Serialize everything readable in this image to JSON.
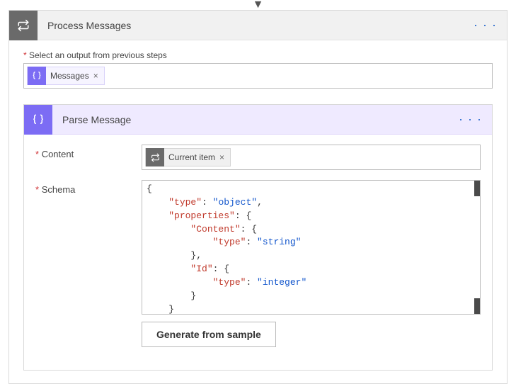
{
  "outer": {
    "arrow_glyph": "▼",
    "icon_glyph": "refresh-loop",
    "title": "Process Messages",
    "more_glyph": "· · ·",
    "field_label_prefix": "*",
    "field_label": "Select an output from previous steps",
    "token": {
      "icon": "braces",
      "label": "Messages",
      "remove_glyph": "×"
    }
  },
  "inner": {
    "icon_glyph": "braces",
    "title": "Parse Message",
    "more_glyph": "· · ·",
    "content": {
      "label_prefix": "*",
      "label": "Content",
      "token": {
        "icon": "refresh-loop",
        "label": "Current item",
        "remove_glyph": "×"
      }
    },
    "schema": {
      "label_prefix": "*",
      "label": "Schema",
      "lines": [
        {
          "indent": 0,
          "parts": [
            {
              "t": "plain",
              "v": "{"
            }
          ]
        },
        {
          "indent": 1,
          "parts": [
            {
              "t": "key",
              "v": "\"type\""
            },
            {
              "t": "plain",
              "v": ": "
            },
            {
              "t": "val",
              "v": "\"object\""
            },
            {
              "t": "plain",
              "v": ","
            }
          ]
        },
        {
          "indent": 1,
          "parts": [
            {
              "t": "key",
              "v": "\"properties\""
            },
            {
              "t": "plain",
              "v": ": {"
            }
          ]
        },
        {
          "indent": 2,
          "parts": [
            {
              "t": "key",
              "v": "\"Content\""
            },
            {
              "t": "plain",
              "v": ": {"
            }
          ]
        },
        {
          "indent": 3,
          "parts": [
            {
              "t": "key",
              "v": "\"type\""
            },
            {
              "t": "plain",
              "v": ": "
            },
            {
              "t": "val",
              "v": "\"string\""
            }
          ]
        },
        {
          "indent": 2,
          "parts": [
            {
              "t": "plain",
              "v": "},"
            }
          ]
        },
        {
          "indent": 2,
          "parts": [
            {
              "t": "key",
              "v": "\"Id\""
            },
            {
              "t": "plain",
              "v": ": {"
            }
          ]
        },
        {
          "indent": 3,
          "parts": [
            {
              "t": "key",
              "v": "\"type\""
            },
            {
              "t": "plain",
              "v": ": "
            },
            {
              "t": "val",
              "v": "\"integer\""
            }
          ]
        },
        {
          "indent": 2,
          "parts": [
            {
              "t": "plain",
              "v": "}"
            }
          ]
        },
        {
          "indent": 1,
          "parts": [
            {
              "t": "plain",
              "v": "}"
            }
          ]
        }
      ]
    },
    "button_label": "Generate from sample"
  }
}
